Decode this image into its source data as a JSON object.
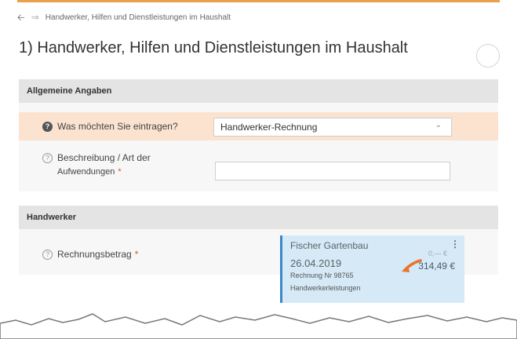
{
  "breadcrumb": {
    "text": "Handwerker, Hilfen und Dienstleistungen im Haushalt"
  },
  "page": {
    "title": "1) Handwerker, Hilfen und Dienstleistungen im Haushalt"
  },
  "sections": {
    "general": {
      "title": "Allgemeine Angaben",
      "entry_type": {
        "label": "Was möchten Sie eintragen?",
        "value": "Handwerker-Rechnung"
      },
      "description": {
        "label_line1": "Beschreibung / Art der",
        "label_line2": "Aufwendungen",
        "required_mark": "*",
        "value": ""
      }
    },
    "craftsman": {
      "title": "Handwerker",
      "invoice_amount": {
        "label": "Rechnungsbetrag",
        "required_mark": "*"
      }
    }
  },
  "document_card": {
    "vendor": "Fischer Gartenbau",
    "date": "26.04.2019",
    "invoice_number": "Rechnung Nr 98765",
    "category": "Handwerkerleistungen",
    "amount": "314,49 €",
    "pending_amount": "0,— €",
    "accent_color": "#3a88c8",
    "arrow_color": "#e9742a"
  },
  "icons": {
    "back": "arrow-left-icon",
    "forward": "arrow-right-icon",
    "info_filled": "info-icon",
    "help": "help-icon",
    "dropdown": "chevron-down-icon",
    "menu": "more-vertical-icon"
  },
  "colors": {
    "accent": "#e9a04a",
    "highlight_row": "#fbe3d0",
    "section_header": "#e4e4e4",
    "required": "#e0533d"
  }
}
